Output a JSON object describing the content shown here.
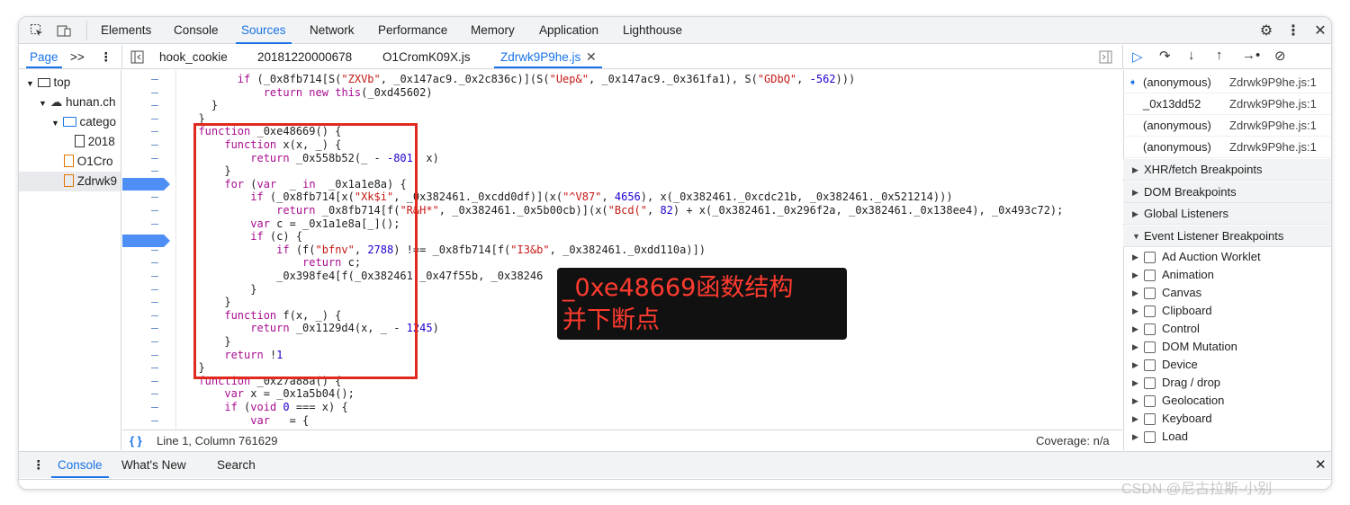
{
  "main_tabs": [
    "Elements",
    "Console",
    "Sources",
    "Network",
    "Performance",
    "Memory",
    "Application",
    "Lighthouse"
  ],
  "active_main_tab": "Sources",
  "sources_subtabs": {
    "page": "Page",
    "more": ">>",
    "files": [
      "hook_cookie",
      "20181220000678",
      "O1CromK09X.js",
      "Zdrwk9P9he.js"
    ],
    "active_file": "Zdrwk9P9he.js"
  },
  "navigator": {
    "items": [
      "top",
      "hunan.ch",
      "catego",
      "2018",
      "O1Cro",
      "Zdrwk9"
    ]
  },
  "code_lines": [
    "        if (_0x8fb714[S(\"ZXVb\", _0x147ac9._0x2c836c)](S(\"Uep&\", _0x147ac9._0x361fa1), S(\"GDbQ\", -562)))",
    "            return new this(_0xd45602)",
    "    }",
    "  }",
    "  function _0xe48669() {",
    "      function x(x, _) {",
    "          return _0x558b52(_ - -801, x)",
    "      }",
    "      for (var  _ in  _0x1a1e8a) {",
    "          if (_0x8fb714[x(\"Xk$i\", _0x382461._0xcdd0df)](x(\"^V87\", 4656), x(_0x382461._0xcdc21b, _0x382461._0x521214)))",
    "              return _0x8fb714[f(\"R&H*\", _0x382461._0x5b00cb)](x(\"Bcd(\", 82) + x(_0x382461._0x296f2a, _0x382461._0x138ee4), _0x493c72);",
    "          var c = _0x1a1e8a[_]();",
    "          if (c) {",
    "              if (f(\"bfnv\", 2788) !== _0x8fb714[f(\"I3&b\", _0x382461._0xdd110a)])",
    "                  return c;",
    "              _0x398fe4[f(_0x382461._0x47f55b, _0x38246",
    "          }",
    "      }",
    "      function f(x, _) {",
    "          return _0x1129d4(x, _ - 1245)",
    "      }",
    "      return !1",
    "  }",
    "  function _0x27a88a() {",
    "      var x = _0x1a5b04();",
    "      if (void 0 === x) {",
    "          var   = {"
  ],
  "annotation": {
    "line1": "_0xe48669函数结构",
    "line2": "并下断点"
  },
  "status_bar": {
    "position": "Line 1, Column 761629",
    "coverage": "Coverage: n/a",
    "braces": "{ }"
  },
  "call_stack": [
    {
      "name": "(anonymous)",
      "location": "Zdrwk9P9he.js:1"
    },
    {
      "name": "_0x13dd52",
      "location": "Zdrwk9P9he.js:1"
    },
    {
      "name": "(anonymous)",
      "location": "Zdrwk9P9he.js:1"
    },
    {
      "name": "(anonymous)",
      "location": "Zdrwk9P9he.js:1"
    }
  ],
  "breakpoint_sections": [
    "XHR/fetch Breakpoints",
    "DOM Breakpoints",
    "Global Listeners",
    "Event Listener Breakpoints"
  ],
  "event_listener_categories": [
    "Ad Auction Worklet",
    "Animation",
    "Canvas",
    "Clipboard",
    "Control",
    "DOM Mutation",
    "Device",
    "Drag / drop",
    "Geolocation",
    "Keyboard",
    "Load"
  ],
  "drawer_tabs": [
    "Console",
    "What's New",
    "Search"
  ],
  "active_drawer_tab": "Console",
  "watermark": "CSDN @尼古拉斯-小别"
}
